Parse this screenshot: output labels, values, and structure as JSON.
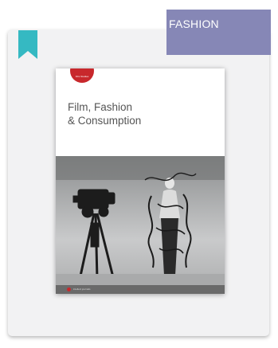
{
  "category": {
    "label": "FASHION"
  },
  "cover": {
    "badge": "Film Studies",
    "title_lines": [
      "Film, Fashion",
      "& Consumption"
    ],
    "footer": "intellect journals"
  },
  "colors": {
    "tab": "#8687b6",
    "bookmark": "#35b9c2",
    "card": "#f2f2f3",
    "badge": "#c8282c"
  },
  "icons": {
    "bookmark": "bookmark-icon"
  }
}
